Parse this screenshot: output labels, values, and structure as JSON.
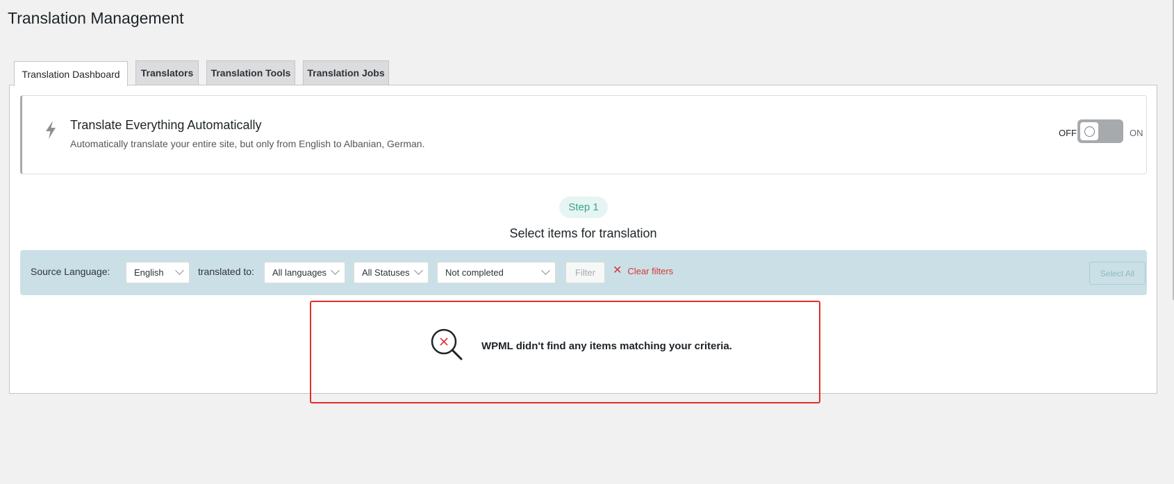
{
  "page": {
    "title": "Translation Management"
  },
  "tabs": [
    {
      "label": "Translation Dashboard",
      "active": true
    },
    {
      "label": "Translators",
      "active": false
    },
    {
      "label": "Translation Tools",
      "active": false
    },
    {
      "label": "Translation Jobs",
      "active": false
    }
  ],
  "ate": {
    "icon": "bolt-icon",
    "title": "Translate Everything Automatically",
    "description": "Automatically translate your entire site, but only from English to Albanian, German.",
    "toggle_off_label": "OFF",
    "toggle_on_label": "ON",
    "enabled": false
  },
  "step": {
    "badge": "Step 1",
    "heading": "Select items for translation"
  },
  "filters": {
    "source_language_label": "Source Language:",
    "source_language_value": "English",
    "translated_to_label": "translated to:",
    "target_language_value": "All languages",
    "status_value": "All Statuses",
    "completion_value": "Not completed",
    "filter_button": "Filter",
    "clear_filters": "Clear filters",
    "select_all_button": "Select All"
  },
  "empty_state": {
    "icon": "search-no-results-icon",
    "message": "WPML didn't find any items matching your criteria."
  },
  "colors": {
    "filter_bar_bg": "#cbe0e6",
    "step_badge_text": "#33a390",
    "clear_filters": "#d63638",
    "highlight_border": "#e22b2b"
  }
}
